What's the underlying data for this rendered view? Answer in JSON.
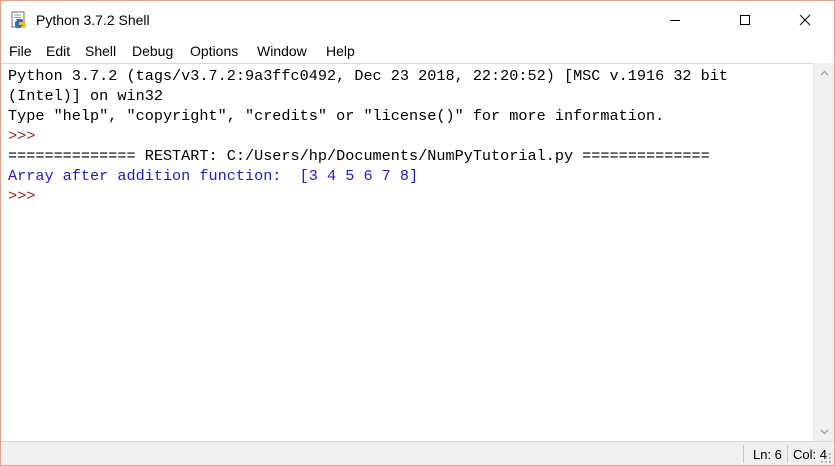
{
  "window": {
    "title": "Python 3.7.2 Shell",
    "icon": "python-idle-icon"
  },
  "menubar": {
    "items": [
      "File",
      "Edit",
      "Shell",
      "Debug",
      "Options",
      "Window",
      "Help"
    ]
  },
  "shell": {
    "lines": [
      {
        "text": "Python 3.7.2 (tags/v3.7.2:9a3ffc0492, Dec 23 2018, 22:20:52) [MSC v.1916 32 bit",
        "kind": "output"
      },
      {
        "text": "(Intel)] on win32",
        "kind": "output"
      },
      {
        "text": "Type \"help\", \"copyright\", \"credits\" or \"license()\" for more information.",
        "kind": "output"
      },
      {
        "text": ">>> ",
        "kind": "prompt"
      },
      {
        "text": "============== RESTART: C:/Users/hp/Documents/NumPyTutorial.py ==============",
        "kind": "output"
      },
      {
        "text": "Array after addition function:  [3 4 5 6 7 8]",
        "kind": "stdout"
      },
      {
        "text": ">>> ",
        "kind": "prompt"
      }
    ]
  },
  "statusbar": {
    "line": "Ln: 6",
    "col": "Col: 4"
  },
  "colors": {
    "prompt": "#9b1c1c",
    "stdout": "#1c1cc8",
    "output": "#000000"
  }
}
